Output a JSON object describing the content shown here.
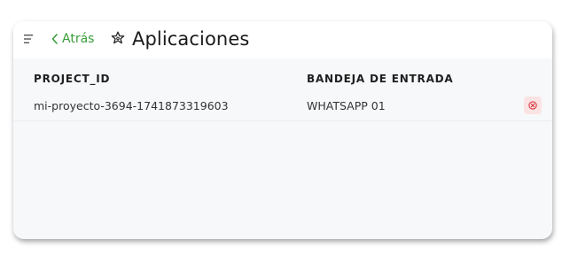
{
  "header": {
    "back_label": "Atrás",
    "title": "Aplicaciones",
    "menu_icon": "menu-lines-icon",
    "title_icon": "puzzle-star-icon"
  },
  "table": {
    "columns": [
      "PROJECT_ID",
      "BANDEJA DE ENTRADA"
    ],
    "rows": [
      {
        "project_id": "mi-proyecto-3694-1741873319603",
        "inbox": "WHATSAPP 01",
        "action_icon": "close-circle-icon"
      }
    ]
  },
  "colors": {
    "accent_green": "#3a9d3a",
    "delete_bg": "#fbe3e4",
    "delete_icon": "#d9363e",
    "card_bg": "#f7f8fa"
  }
}
